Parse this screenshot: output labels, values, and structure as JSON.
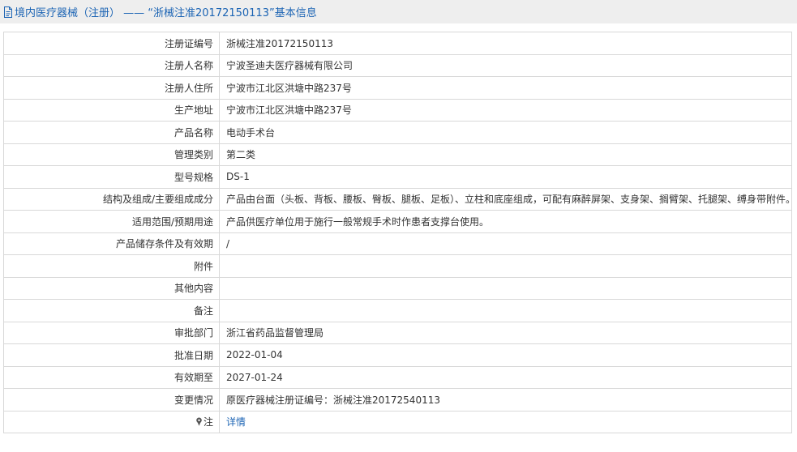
{
  "header": {
    "title": "境内医疗器械（注册） —— “浙械注准20172150113”基本信息",
    "icon": "document-icon"
  },
  "rows": [
    {
      "label": "注册证编号",
      "value": "浙械注准20172150113"
    },
    {
      "label": "注册人名称",
      "value": "宁波圣迪夫医疗器械有限公司"
    },
    {
      "label": "注册人住所",
      "value": "宁波市江北区洪塘中路237号"
    },
    {
      "label": "生产地址",
      "value": "宁波市江北区洪塘中路237号"
    },
    {
      "label": "产品名称",
      "value": "电动手术台"
    },
    {
      "label": "管理类别",
      "value": "第二类"
    },
    {
      "label": "型号规格",
      "value": "DS-1"
    },
    {
      "label": "结构及组成/主要组成成分",
      "value": "产品由台面（头板、背板、腰板、臀板、腿板、足板）、立柱和底座组成，可配有麻醉屏架、支身架、搁臂架、托腿架、缚身带附件。"
    },
    {
      "label": "适用范围/预期用途",
      "value": "产品供医疗单位用于施行一般常规手术时作患者支撑台使用。"
    },
    {
      "label": "产品储存条件及有效期",
      "value": "/"
    },
    {
      "label": "附件",
      "value": ""
    },
    {
      "label": "其他内容",
      "value": ""
    },
    {
      "label": "备注",
      "value": ""
    },
    {
      "label": "审批部门",
      "value": "浙江省药品监督管理局"
    },
    {
      "label": "批准日期",
      "value": "2022-01-04"
    },
    {
      "label": "有效期至",
      "value": "2027-01-24"
    },
    {
      "label": "变更情况",
      "value": "原医疗器械注册证编号：浙械注准20172540113"
    }
  ],
  "note_row": {
    "label": "注",
    "icon": "pin-icon",
    "link_text": "详情"
  },
  "colors": {
    "accent": "#1c64b4",
    "header_bg": "#eeeeee",
    "border": "#d8d8d8",
    "text": "#333333"
  }
}
